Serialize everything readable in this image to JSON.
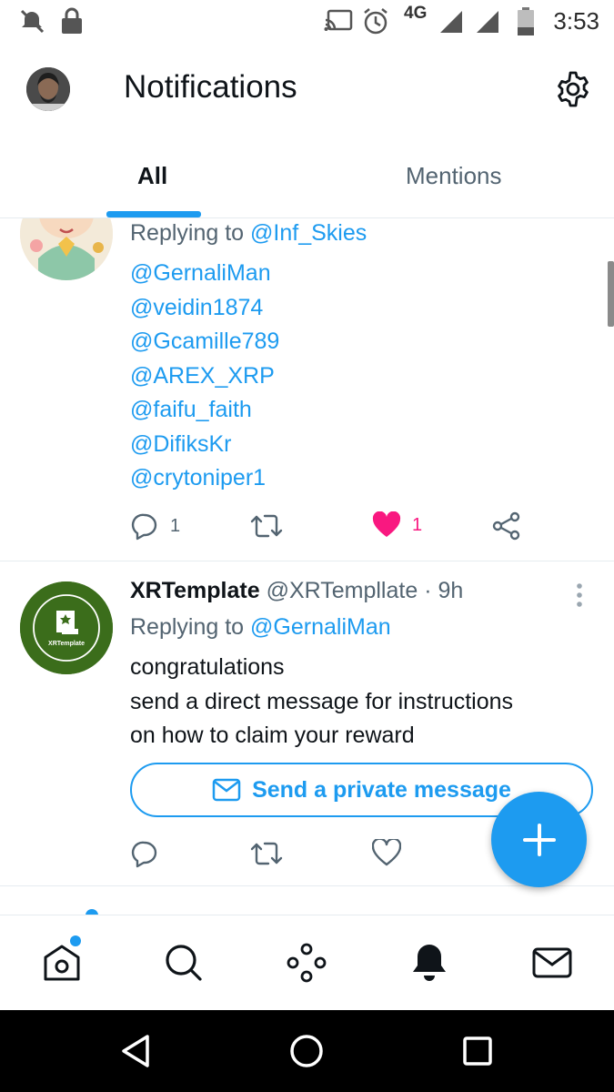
{
  "status_bar": {
    "network": "4G",
    "time": "3:53",
    "icons": [
      "notifications-off-icon",
      "lock-icon",
      "cast-icon",
      "alarm-icon",
      "signal-icon",
      "signal-icon",
      "battery-icon"
    ]
  },
  "header": {
    "title": "Notifications",
    "settings_icon": "gear-icon"
  },
  "tabs": [
    {
      "label": "All",
      "selected": true
    },
    {
      "label": "Mentions",
      "selected": false
    }
  ],
  "tweets": [
    {
      "replying_prefix": "Replying to",
      "replying_to": "@Inf_Skies",
      "mentions": [
        "@GernaliMan",
        "@veidin1874",
        "@Gcamille789",
        "@AREX_XRP",
        "@faifu_faith",
        "@DifiksKr",
        "@crytoniper1"
      ],
      "reply_count": "1",
      "like_count": "1",
      "liked": true,
      "colors": {
        "like": "#f91880",
        "link": "#1d9bf0"
      }
    },
    {
      "name": "XRTemplate",
      "handle": "@XRTempllate",
      "time": "· 9h",
      "avatar_text": "XRTemplate",
      "replying_prefix": "Replying to",
      "replying_to": "@GernaliMan",
      "body_lines": [
        "congratulations",
        "send a direct message for instructions",
        "on how to claim your reward"
      ],
      "dm_button_label": "Send a private message"
    }
  ],
  "bottom_nav": {
    "items": [
      "home-icon",
      "search-icon",
      "spaces-icon",
      "notifications-icon",
      "messages-icon"
    ],
    "active": "notifications-icon"
  },
  "system_nav": [
    "back-icon",
    "home-icon",
    "recents-icon"
  ]
}
